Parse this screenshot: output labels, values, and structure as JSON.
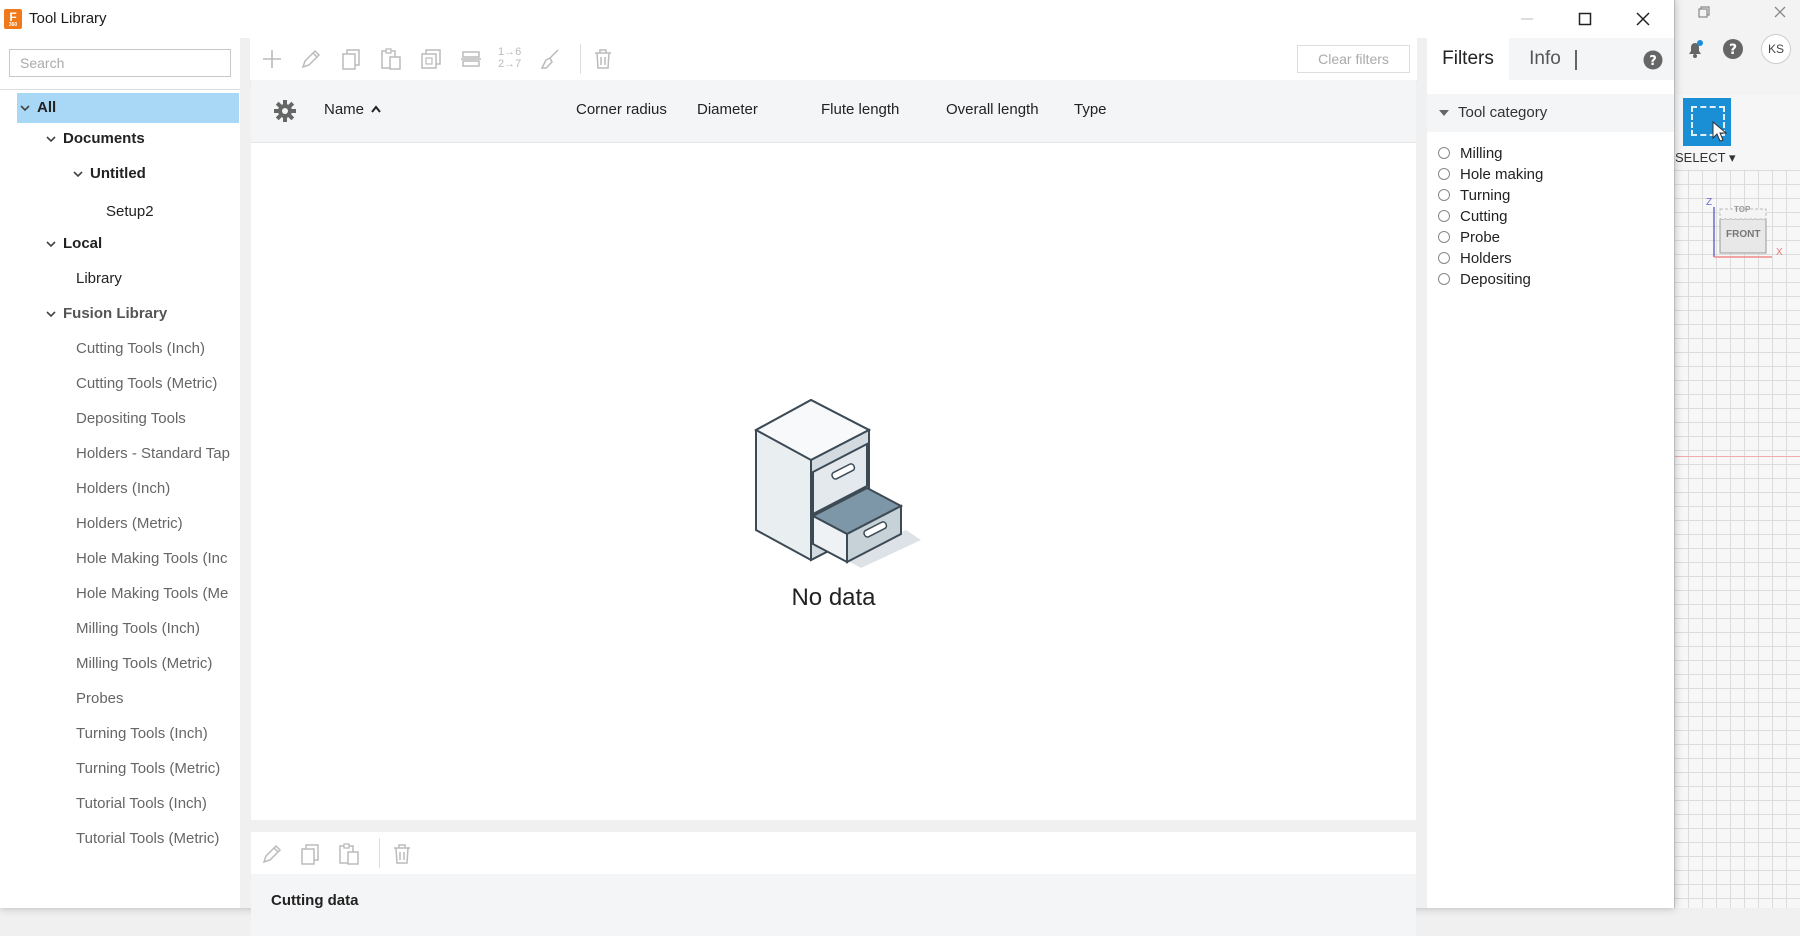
{
  "window": {
    "title": "Tool Library",
    "app_badge": "F",
    "app_badge_sub": "360"
  },
  "search": {
    "placeholder": "Search",
    "value": ""
  },
  "tree": {
    "all": "All",
    "documents": "Documents",
    "untitled": "Untitled",
    "setup2": "Setup2",
    "local": "Local",
    "library": "Library",
    "fusion_library": "Fusion Library",
    "fusion_items": [
      "Cutting Tools (Inch)",
      "Cutting Tools (Metric)",
      "Depositing Tools",
      "Holders - Standard Tap",
      "Holders (Inch)",
      "Holders (Metric)",
      "Hole Making Tools (Inc",
      "Hole Making Tools (Me",
      "Milling Tools (Inch)",
      "Milling Tools (Metric)",
      "Probes",
      "Turning Tools (Inch)",
      "Turning Tools (Metric)",
      "Tutorial Tools (Inch)",
      "Tutorial Tools (Metric)"
    ]
  },
  "toolbar": {
    "clear_filters": "Clear filters",
    "renumber_top": "1→6",
    "renumber_bottom": "2→7",
    "icons": [
      "plus-icon",
      "edit-icon",
      "copy-icon",
      "paste-icon",
      "duplicate-icon",
      "merge-icon",
      "renumber-icon",
      "cleanup-icon",
      "delete-icon"
    ]
  },
  "table": {
    "columns": {
      "name": "Name",
      "corner_radius": "Corner radius",
      "diameter": "Diameter",
      "flute_length": "Flute length",
      "overall_length": "Overall length",
      "type": "Type"
    },
    "sort": "ascending",
    "empty_text": "No data"
  },
  "bottom_panel": {
    "title": "Cutting data"
  },
  "filters": {
    "tab_filters": "Filters",
    "tab_info": "Info",
    "section_title": "Tool category",
    "categories": [
      "Milling",
      "Hole making",
      "Turning",
      "Cutting",
      "Probe",
      "Holders",
      "Depositing"
    ]
  },
  "background_app": {
    "select_label": "SELECT ▾",
    "user_initials": "KS",
    "viewcube_top": "TOP",
    "viewcube_front": "FRONT",
    "axis_z": "Z",
    "axis_x": "X"
  },
  "colors": {
    "selection": "#a8d8f5",
    "accent": "#1b8fd6",
    "app_icon": "#f07a1a"
  }
}
